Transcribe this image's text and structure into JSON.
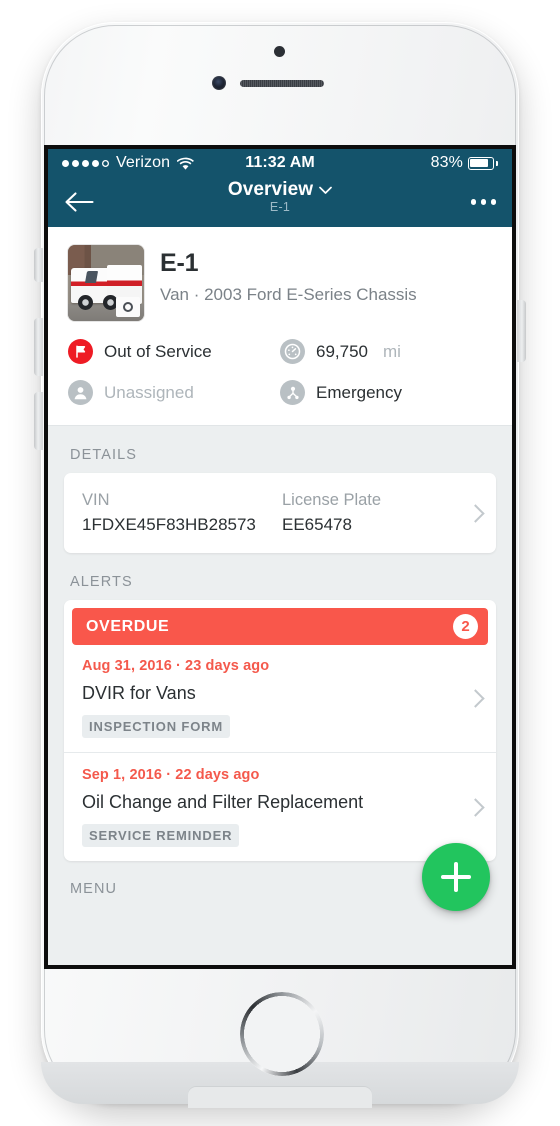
{
  "status_bar": {
    "carrier": "Verizon",
    "signal_dots_filled": 4,
    "signal_dots_total": 5,
    "wifi_icon": "wifi-icon",
    "time": "11:32 AM",
    "battery_percent": "83%",
    "battery_level": 83
  },
  "nav_bar": {
    "back_icon": "arrow-left-icon",
    "title": "Overview",
    "title_chevron_icon": "chevron-down-icon",
    "subtitle": "E-1",
    "overflow_icon": "overflow-dots-icon",
    "background_color": "#14536b"
  },
  "vehicle": {
    "thumbnail_icon": "vehicle-photo",
    "camera_badge_icon": "camera-icon",
    "name": "E-1",
    "description": "Van · 2003 Ford E-Series Chassis",
    "status": [
      {
        "icon": "flag-icon",
        "icon_style": "red",
        "label": "Out of Service",
        "muted": false,
        "unit": ""
      },
      {
        "icon": "gauge-icon",
        "icon_style": "gauge",
        "label": "69,750",
        "muted": false,
        "unit": "mi"
      },
      {
        "icon": "person-icon",
        "icon_style": "grey",
        "label": "Unassigned",
        "muted": true,
        "unit": ""
      },
      {
        "icon": "group-hierarchy-icon",
        "icon_style": "grey",
        "label": "Emergency",
        "muted": false,
        "unit": ""
      }
    ]
  },
  "details": {
    "section_label": "DETAILS",
    "fields": [
      {
        "label": "VIN",
        "value": "1FDXE45F83HB28573"
      },
      {
        "label": "License Plate",
        "value": "EE65478"
      }
    ],
    "chevron_icon": "chevron-right-icon"
  },
  "alerts": {
    "section_label": "ALERTS",
    "banner": {
      "label": "OVERDUE",
      "count": "2",
      "color": "#f9574b"
    },
    "items": [
      {
        "date": "Aug 31, 2016 · 23 days ago",
        "title": "DVIR for Vans",
        "tag": "INSPECTION FORM",
        "chevron_icon": "chevron-right-icon"
      },
      {
        "date": "Sep 1, 2016 · 22 days ago",
        "title": "Oil Change and Filter Replacement",
        "tag": "SERVICE REMINDER",
        "chevron_icon": "chevron-right-icon"
      }
    ]
  },
  "menu": {
    "section_label": "MENU"
  },
  "fab": {
    "icon": "plus-icon",
    "color": "#22c55e"
  }
}
